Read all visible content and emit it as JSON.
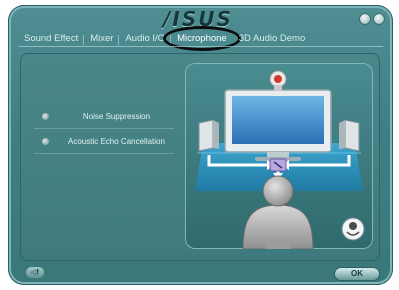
{
  "window": {
    "brand": "/ISUS",
    "minimize_label": "○",
    "close_label": "×"
  },
  "tabs": [
    {
      "label": "Sound Effect",
      "active": false
    },
    {
      "label": "Mixer",
      "active": false
    },
    {
      "label": "Audio I/O",
      "active": false
    },
    {
      "label": "Microphone",
      "active": true
    },
    {
      "label": "3D Audio Demo",
      "active": false
    }
  ],
  "options": [
    {
      "label": "Noise Suppression"
    },
    {
      "label": "Acoustic Echo Cancellation"
    }
  ],
  "footer": {
    "help_label": "◁!",
    "ok_label": "OK"
  },
  "colors": {
    "panel": "#3f7f84",
    "accent": "#a8d2d4",
    "illustration_floor": "#2b8fb8",
    "mic_red": "#d23b2b"
  }
}
